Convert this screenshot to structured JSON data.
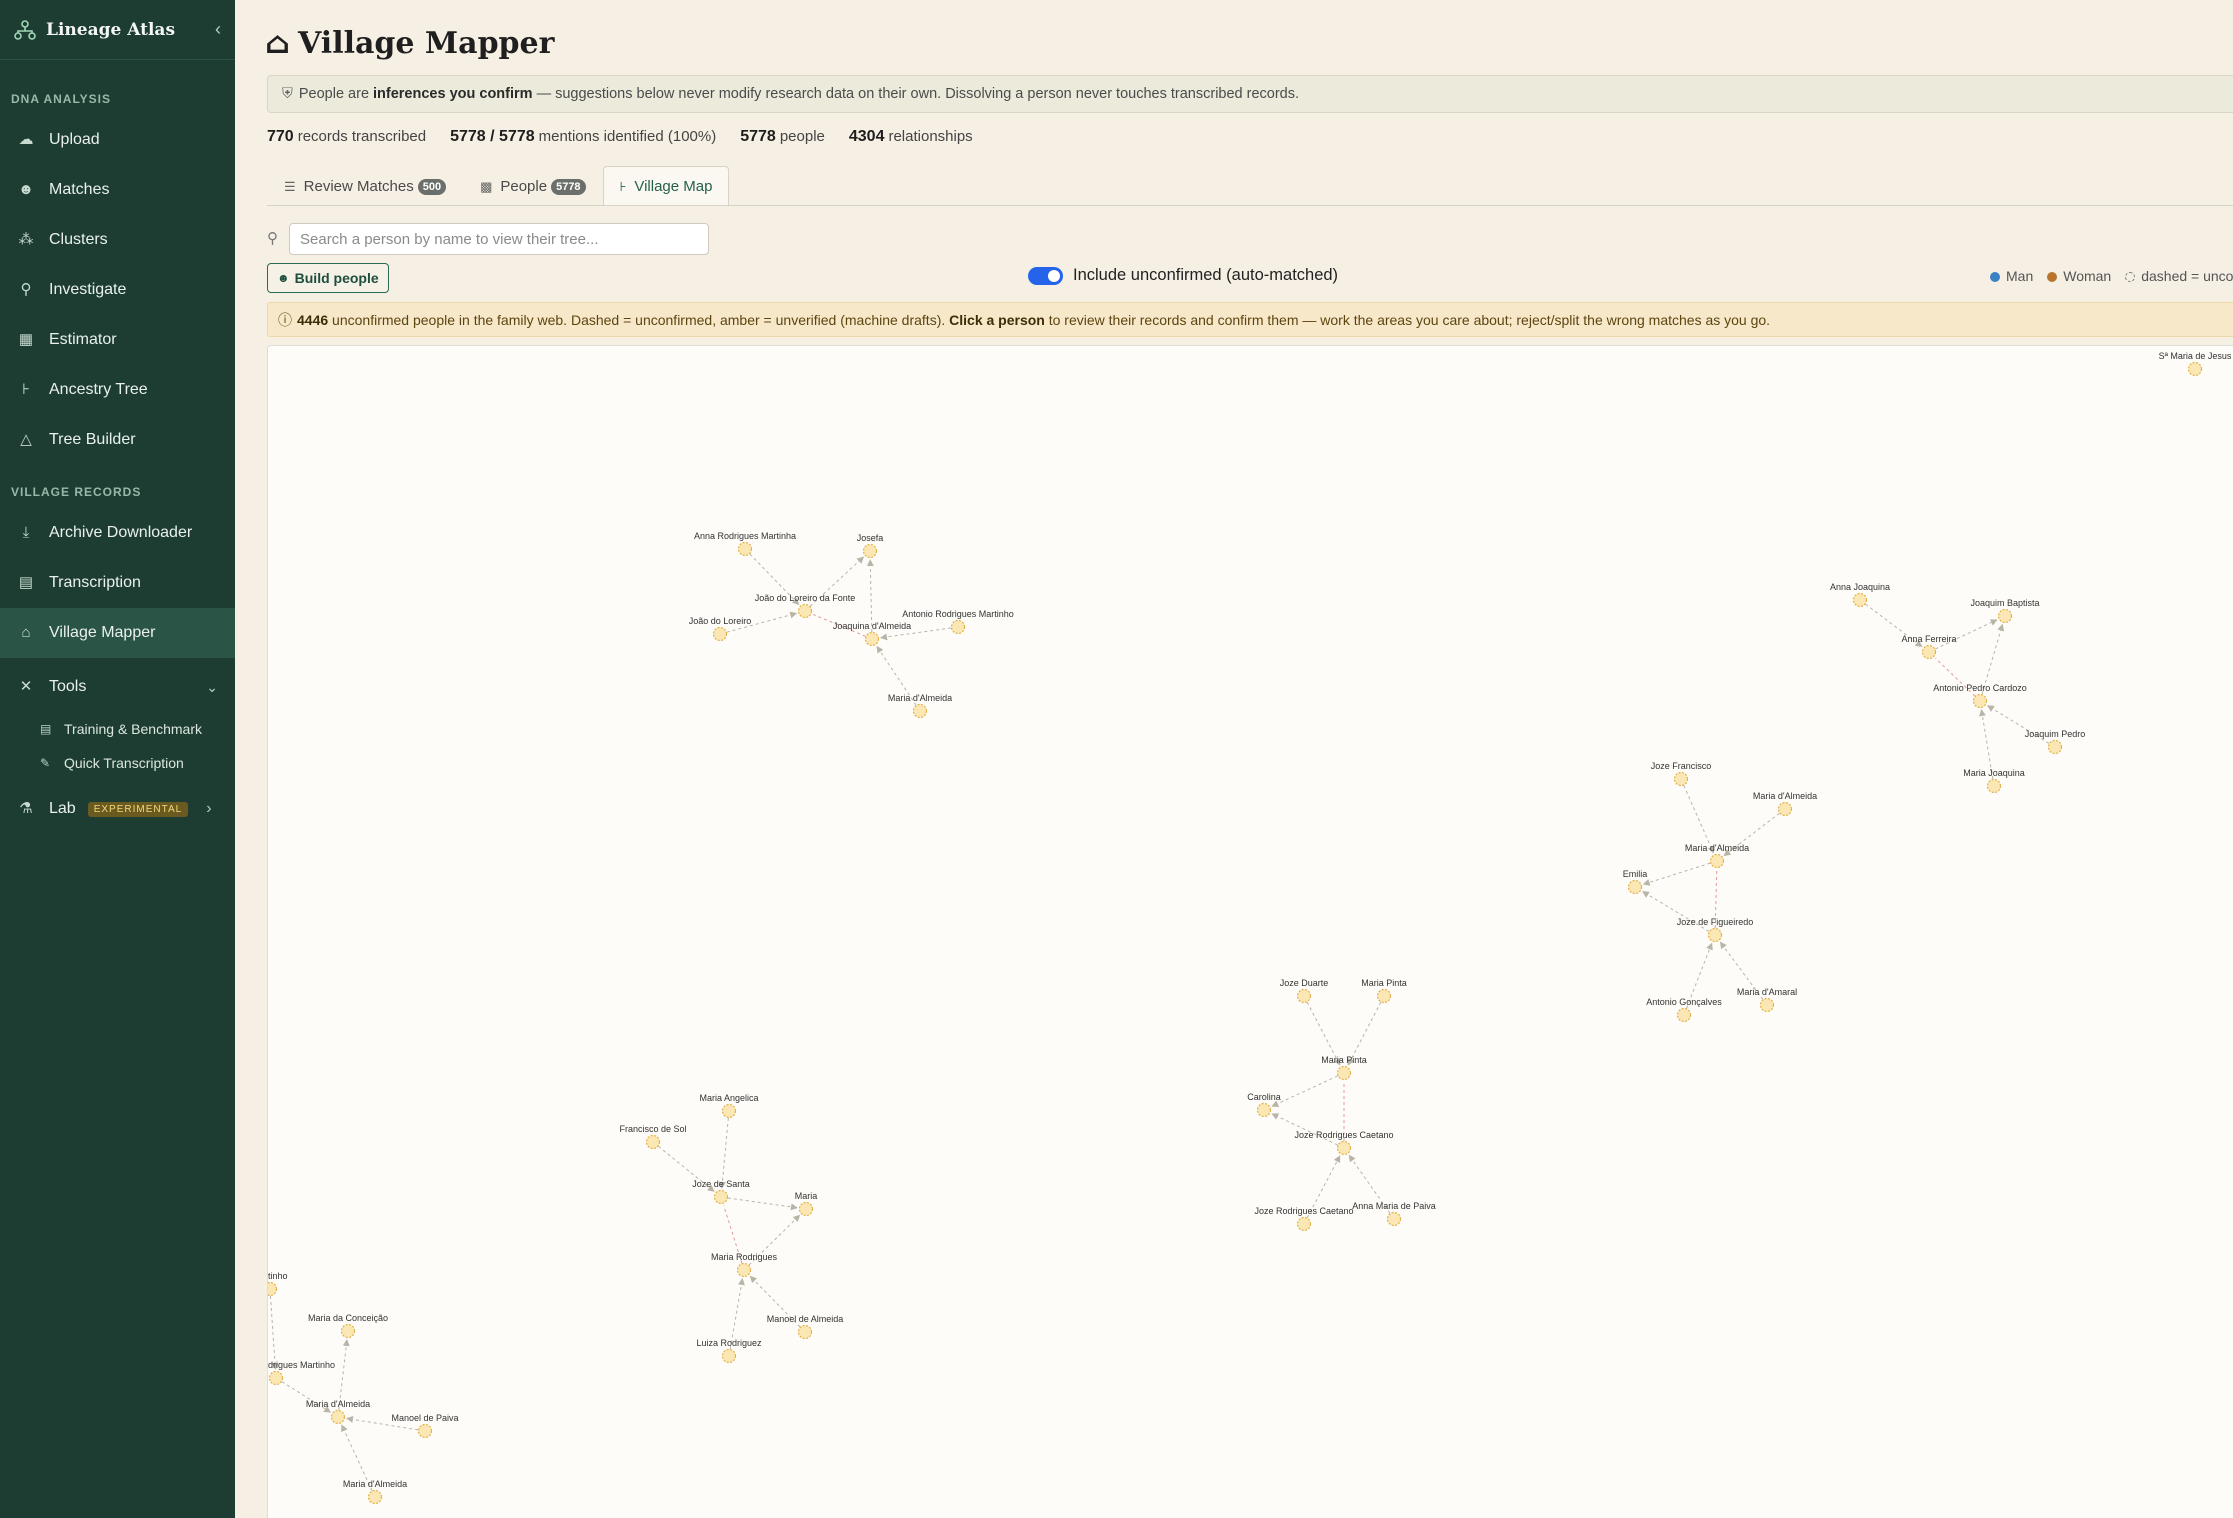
{
  "sidebar": {
    "brand": "Lineage Atlas",
    "dna_label": "DNA ANALYSIS",
    "dna_items": [
      {
        "label": "Upload",
        "icon": "cloud-upload-icon"
      },
      {
        "label": "Matches",
        "icon": "users-icon"
      },
      {
        "label": "Clusters",
        "icon": "cluster-icon"
      },
      {
        "label": "Investigate",
        "icon": "search-icon"
      },
      {
        "label": "Estimator",
        "icon": "calculator-icon"
      },
      {
        "label": "Ancestry Tree",
        "icon": "tree-icon"
      },
      {
        "label": "Tree Builder",
        "icon": "bell-icon"
      }
    ],
    "village_label": "VILLAGE RECORDS",
    "village_items": [
      {
        "label": "Archive Downloader",
        "icon": "download-icon"
      },
      {
        "label": "Transcription",
        "icon": "document-icon"
      },
      {
        "label": "Village Mapper",
        "icon": "home-icon"
      }
    ],
    "tools_label": "Tools",
    "tools_items": [
      {
        "label": "Training & Benchmark"
      },
      {
        "label": "Quick Transcription"
      }
    ],
    "lab_label": "Lab",
    "lab_badge": "EXPERIMENTAL"
  },
  "page": {
    "title": "Village Mapper",
    "notice_pre": "People are ",
    "notice_bold": "inferences you confirm",
    "notice_post": " — suggestions below never modify research data on their own. Dissolving a person never touches transcribed records.",
    "stats": [
      {
        "value": "770",
        "label": "records transcribed"
      },
      {
        "value": "5778 / 5778",
        "label": "mentions identified (100%)"
      },
      {
        "value": "5778",
        "label": "people"
      },
      {
        "value": "4304",
        "label": "relationships"
      }
    ],
    "tabs": [
      {
        "label": "Review Matches",
        "count": "500"
      },
      {
        "label": "People",
        "count": "5778"
      },
      {
        "label": "Village Map",
        "count": ""
      }
    ],
    "search_placeholder": "Search a person by name to view their tree...",
    "build_label": "Build people",
    "toggle_label": "Include unconfirmed (auto-matched)",
    "legend": {
      "man": "Man",
      "woman": "Woman",
      "dashed": "dashed = unco"
    },
    "warn_count": "4446",
    "warn_text": " unconfirmed people in the family web. Dashed = unconfirmed, amber = unverified (machine drafts). ",
    "warn_bold": "Click a person",
    "warn_post": " to review their records and confirm them — work the areas you care about; reject/split the wrong matches as you go."
  },
  "map": {
    "colors": {
      "node_fill": "#fbe7b3",
      "node_stroke": "#e2b04a",
      "edge": "#b9b4a8",
      "edge_partner": "#e59a9a"
    },
    "nodes": [
      {
        "id": "n1",
        "label": "Anna Rodrigues Martinha"
      },
      {
        "id": "n2",
        "label": "Josefa"
      },
      {
        "id": "n3",
        "label": "João do Loreiro da Fonte"
      },
      {
        "id": "n4",
        "label": "João do Loreiro"
      },
      {
        "id": "n5",
        "label": "Joaquina d'Almeida"
      },
      {
        "id": "n6",
        "label": "Antonio Rodrigues Martinho"
      },
      {
        "id": "n7",
        "label": "Maria d'Almeida"
      },
      {
        "id": "n8",
        "label": "Sª Maria de Jesus"
      },
      {
        "id": "n9",
        "label": "Anna Joaquina"
      },
      {
        "id": "n10",
        "label": "Joaquim Baptista"
      },
      {
        "id": "n11",
        "label": "Anna Ferreira"
      },
      {
        "id": "n12",
        "label": "Antonio Pedro Cardozo"
      },
      {
        "id": "n13",
        "label": "Joaquim Pedro"
      },
      {
        "id": "n14",
        "label": "Maria Joaquina"
      },
      {
        "id": "n15",
        "label": "Joze Francisco"
      },
      {
        "id": "n16",
        "label": "Maria d'Almeida"
      },
      {
        "id": "n17",
        "label": "Maria d'Almeida"
      },
      {
        "id": "n18",
        "label": "Emilia"
      },
      {
        "id": "n19",
        "label": "Joze de Figueiredo"
      },
      {
        "id": "n20",
        "label": "Antonio Gonçalves"
      },
      {
        "id": "n21",
        "label": "Maria d'Amaral"
      },
      {
        "id": "n22",
        "label": "Joze Duarte"
      },
      {
        "id": "n23",
        "label": "Maria Pinta"
      },
      {
        "id": "n24",
        "label": "Maria Pinta"
      },
      {
        "id": "n25",
        "label": "Carolina"
      },
      {
        "id": "n26",
        "label": "Joze Rodrigues Caetano"
      },
      {
        "id": "n27",
        "label": "Joze Rodrigues Caetano"
      },
      {
        "id": "n28",
        "label": "Anna Maria de Paiva"
      },
      {
        "id": "n29",
        "label": "Maria Angelica"
      },
      {
        "id": "n30",
        "label": "Francisco de Sol"
      },
      {
        "id": "n31",
        "label": "Joze de Santa"
      },
      {
        "id": "n32",
        "label": "Maria"
      },
      {
        "id": "n33",
        "label": "Maria Rodrigues"
      },
      {
        "id": "n34",
        "label": "Manoel de Almeida"
      },
      {
        "id": "n35",
        "label": "Luiza Rodriguez"
      },
      {
        "id": "n36",
        "label": "tinho"
      },
      {
        "id": "n37",
        "label": "Maria da Conceição"
      },
      {
        "id": "n38",
        "label": "drigues Martinho"
      },
      {
        "id": "n39",
        "label": "Maria d'Almeida"
      },
      {
        "id": "n40",
        "label": "Manoel de Paiva"
      },
      {
        "id": "n41",
        "label": "Maria d'Almeida"
      }
    ]
  }
}
